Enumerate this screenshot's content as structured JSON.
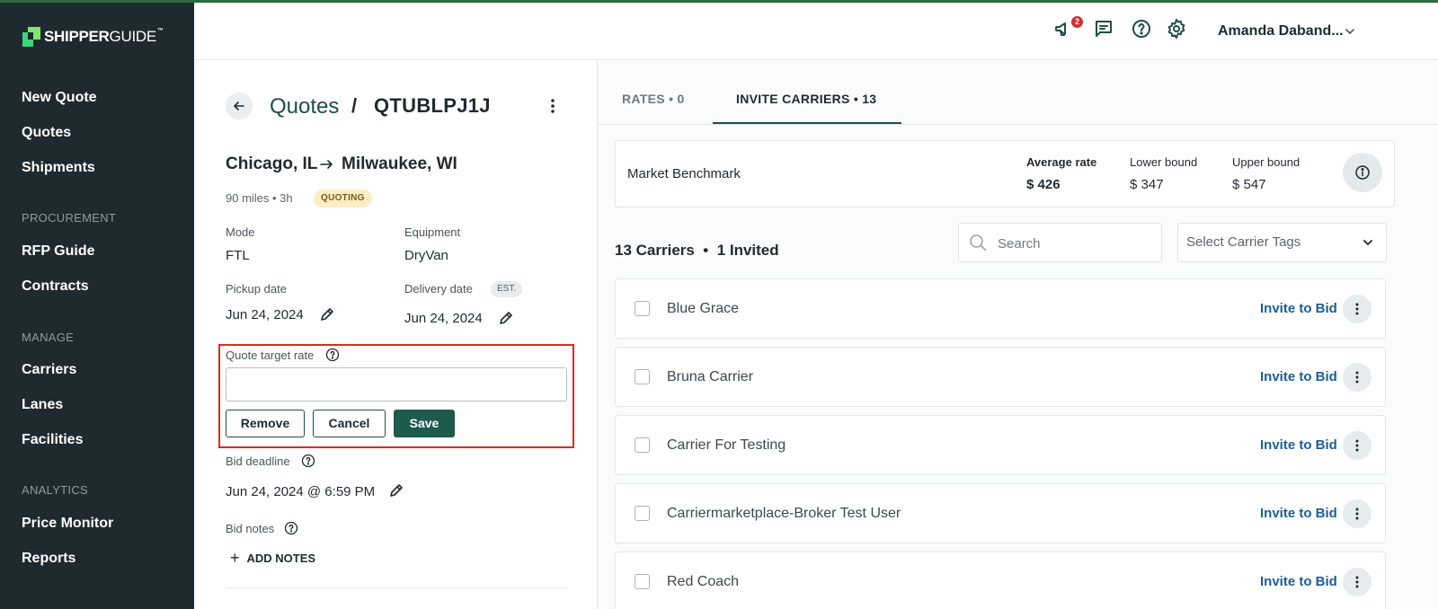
{
  "app": {
    "logo_bold": "SHIPPER",
    "logo_light": "GUIDE",
    "logo_tm": "™"
  },
  "sidebar": {
    "items": [
      {
        "label": "New Quote"
      },
      {
        "label": "Quotes"
      },
      {
        "label": "Shipments"
      }
    ],
    "section_procurement": "PROCUREMENT",
    "procurement_items": [
      {
        "label": "RFP Guide"
      },
      {
        "label": "Contracts"
      }
    ],
    "section_manage": "MANAGE",
    "manage_items": [
      {
        "label": "Carriers"
      },
      {
        "label": "Lanes"
      },
      {
        "label": "Facilities"
      }
    ],
    "section_analytics": "ANALYTICS",
    "analytics_items": [
      {
        "label": "Price Monitor"
      },
      {
        "label": "Reports"
      }
    ]
  },
  "header": {
    "notification_count": "2",
    "user_name": "Amanda Daband...",
    "icons": [
      "megaphone-icon",
      "chat-icon",
      "help-icon",
      "settings-icon",
      "chevron-down-icon"
    ]
  },
  "quote": {
    "breadcrumb_parent": "Quotes",
    "breadcrumb_sep": "/",
    "quote_id": "QTUBLPJ1J",
    "origin": "Chicago, IL",
    "destination": "Milwaukee, WI",
    "meta": "90 miles • 3h",
    "status": "QUOTING",
    "mode_label": "Mode",
    "mode_value": "FTL",
    "equipment_label": "Equipment",
    "equipment_value": "DryVan",
    "pickup_label": "Pickup date",
    "pickup_value": "Jun 24, 2024",
    "delivery_label": "Delivery date",
    "delivery_badge": "EST.",
    "delivery_value": "Jun 24, 2024",
    "target_rate_label": "Quote target rate",
    "target_rate_value": "",
    "remove_label": "Remove",
    "cancel_label": "Cancel",
    "save_label": "Save",
    "bid_deadline_label": "Bid deadline",
    "bid_deadline_value": "Jun 24, 2024 @ 6:59 PM",
    "bid_notes_label": "Bid notes",
    "add_notes_label": "ADD NOTES"
  },
  "tabs": {
    "rates": "RATES • 0",
    "invite": "INVITE CARRIERS • 13"
  },
  "benchmark": {
    "title": "Market Benchmark",
    "average_label": "Average rate",
    "average_value": "$ 426",
    "lower_label": "Lower bound",
    "lower_value": "$ 347",
    "upper_label": "Upper bound",
    "upper_value": "$ 547"
  },
  "carriers": {
    "summary": "13 Carriers  •  1 Invited",
    "search_placeholder": "Search",
    "tags_placeholder": "Select Carrier Tags",
    "invite_label": "Invite to Bid",
    "list": [
      {
        "name": "Blue Grace"
      },
      {
        "name": "Bruna Carrier"
      },
      {
        "name": "Carrier For Testing"
      },
      {
        "name": "Carriermarketplace-Broker Test User"
      },
      {
        "name": "Red Coach"
      }
    ]
  },
  "colors": {
    "sidebar_bg": "#1f2a30",
    "brand_green": "#1f5a4f",
    "link_blue": "#1b5e9c",
    "highlight_red": "#e0291f",
    "badge_red": "#d0302f"
  }
}
